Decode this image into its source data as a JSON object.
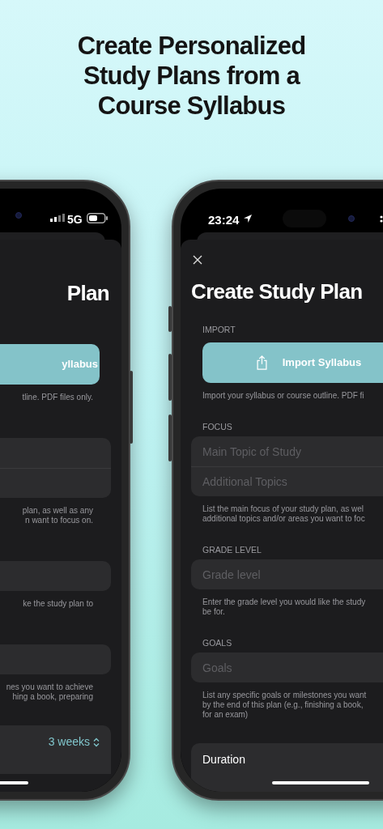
{
  "headline": {
    "lines": [
      "Create Personalized",
      "Study Plans from a",
      "Course Syllabus"
    ]
  },
  "phones": [
    {
      "kind": "left",
      "status": {
        "network": "5G"
      },
      "title": "Plan",
      "sections": [
        {
          "kind": "import",
          "button": "yllabus",
          "help": [
            "tline. PDF files only."
          ]
        },
        {
          "kind": "fields",
          "fields": [
            {
              "kind": "text_field"
            },
            {
              "kind": "text_field"
            }
          ],
          "help": [
            "plan, as well as any",
            "n want to focus on."
          ]
        },
        {
          "kind": "fields",
          "fields": [
            {
              "kind": "text_field"
            }
          ],
          "help": [
            "ke the study plan to"
          ]
        },
        {
          "kind": "fields",
          "fields": [
            {
              "kind": "text_field"
            }
          ],
          "help": [
            "nes you want to achieve",
            "hing a book, preparing"
          ]
        },
        {
          "kind": "picker",
          "value": "3 weeks"
        }
      ]
    },
    {
      "kind": "right",
      "status": {
        "time": "23:24"
      },
      "title": "Create Study Plan",
      "sections": [
        {
          "kind": "import",
          "label": "IMPORT",
          "button": "Import Syllabus",
          "help": [
            "Import your syllabus or course outline. PDF fi"
          ]
        },
        {
          "kind": "fields",
          "label": "FOCUS",
          "fields": [
            {
              "kind": "text_field",
              "placeholder": "Main Topic of Study"
            },
            {
              "kind": "text_field",
              "placeholder": "Additional Topics"
            }
          ],
          "help": [
            "List the main focus of your study plan, as wel",
            "additional topics and/or areas you want to foc"
          ]
        },
        {
          "kind": "fields",
          "label": "GRADE LEVEL",
          "fields": [
            {
              "kind": "text_field",
              "placeholder": "Grade level"
            }
          ],
          "help": [
            "Enter the grade level you would like the study",
            "be for."
          ]
        },
        {
          "kind": "fields",
          "label": "GOALS",
          "fields": [
            {
              "kind": "text_field",
              "placeholder": "Goals"
            }
          ],
          "help": [
            "List any specific goals or milestones you want",
            "by the end of this plan (e.g., finishing a book,",
            "for an exam)"
          ]
        },
        {
          "kind": "picker",
          "label": "Duration"
        }
      ]
    }
  ]
}
